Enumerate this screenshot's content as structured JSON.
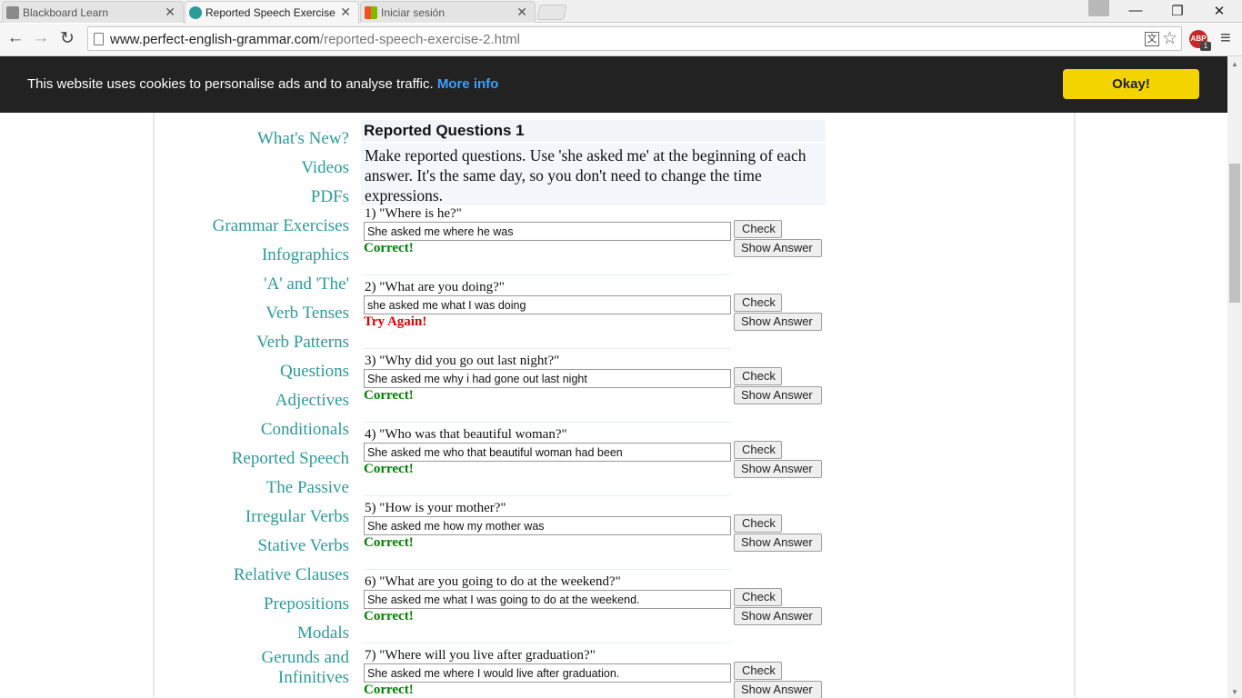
{
  "browser": {
    "tabs": [
      {
        "title": "Blackboard Learn",
        "icon": "blackboard-favicon",
        "active": false
      },
      {
        "title": "Reported Speech Exercise",
        "icon": "perfect-english-favicon",
        "active": true
      },
      {
        "title": "Iniciar sesión",
        "icon": "microsoft-favicon",
        "active": false
      }
    ],
    "url_domain": "www.perfect-english-grammar.com",
    "url_path": "/reported-speech-exercise-2.html",
    "abp_label": "ABP",
    "abp_count": "1"
  },
  "cookie_banner": {
    "text": "This website uses cookies to personalise ads and to analyse traffic.",
    "more_info": "More info",
    "okay_button": "Okay!"
  },
  "sidebar": {
    "items": [
      "What's New?",
      "Videos",
      "PDFs",
      "Grammar Exercises",
      "Infographics",
      "'A' and 'The'",
      "Verb Tenses",
      "Verb Patterns",
      "Questions",
      "Adjectives",
      "Conditionals",
      "Reported Speech",
      "The Passive",
      "Irregular Verbs",
      "Stative Verbs",
      "Relative Clauses",
      "Prepositions",
      "Modals",
      "Gerunds and Infinitives"
    ]
  },
  "exercise": {
    "title": "Reported Questions 1",
    "intro": "Make reported questions. Use 'she asked me' at the beginning of each answer. It's the same day, so you don't need to change the time expressions.",
    "check_label": "Check",
    "show_answer_label": "Show Answer",
    "colors": {
      "correct": "#008000",
      "try_again": "#e00000"
    },
    "questions": [
      {
        "prompt": "1) \"Where is he?\"",
        "answer": "She asked me where he was",
        "result": "Correct!"
      },
      {
        "prompt": "2) \"What are you doing?\"",
        "answer": "she asked me what I was doing",
        "result": "Try Again!"
      },
      {
        "prompt": "3) \"Why did you go out last night?\"",
        "answer": "She asked me why i had gone out last night",
        "result": "Correct!"
      },
      {
        "prompt": "4) \"Who was that beautiful woman?\"",
        "answer": "She asked me who that beautiful woman had been",
        "result": "Correct!"
      },
      {
        "prompt": "5) \"How is your mother?\"",
        "answer": "She asked me how my mother was",
        "result": "Correct!"
      },
      {
        "prompt": "6) \"What are you going to do at the weekend?\"",
        "answer": "She asked me what I was going to do at the weekend.",
        "result": "Correct!"
      },
      {
        "prompt": "7) \"Where will you live after graduation?\"",
        "answer": "She asked me where I would live after graduation.",
        "result": "Correct!"
      }
    ]
  }
}
